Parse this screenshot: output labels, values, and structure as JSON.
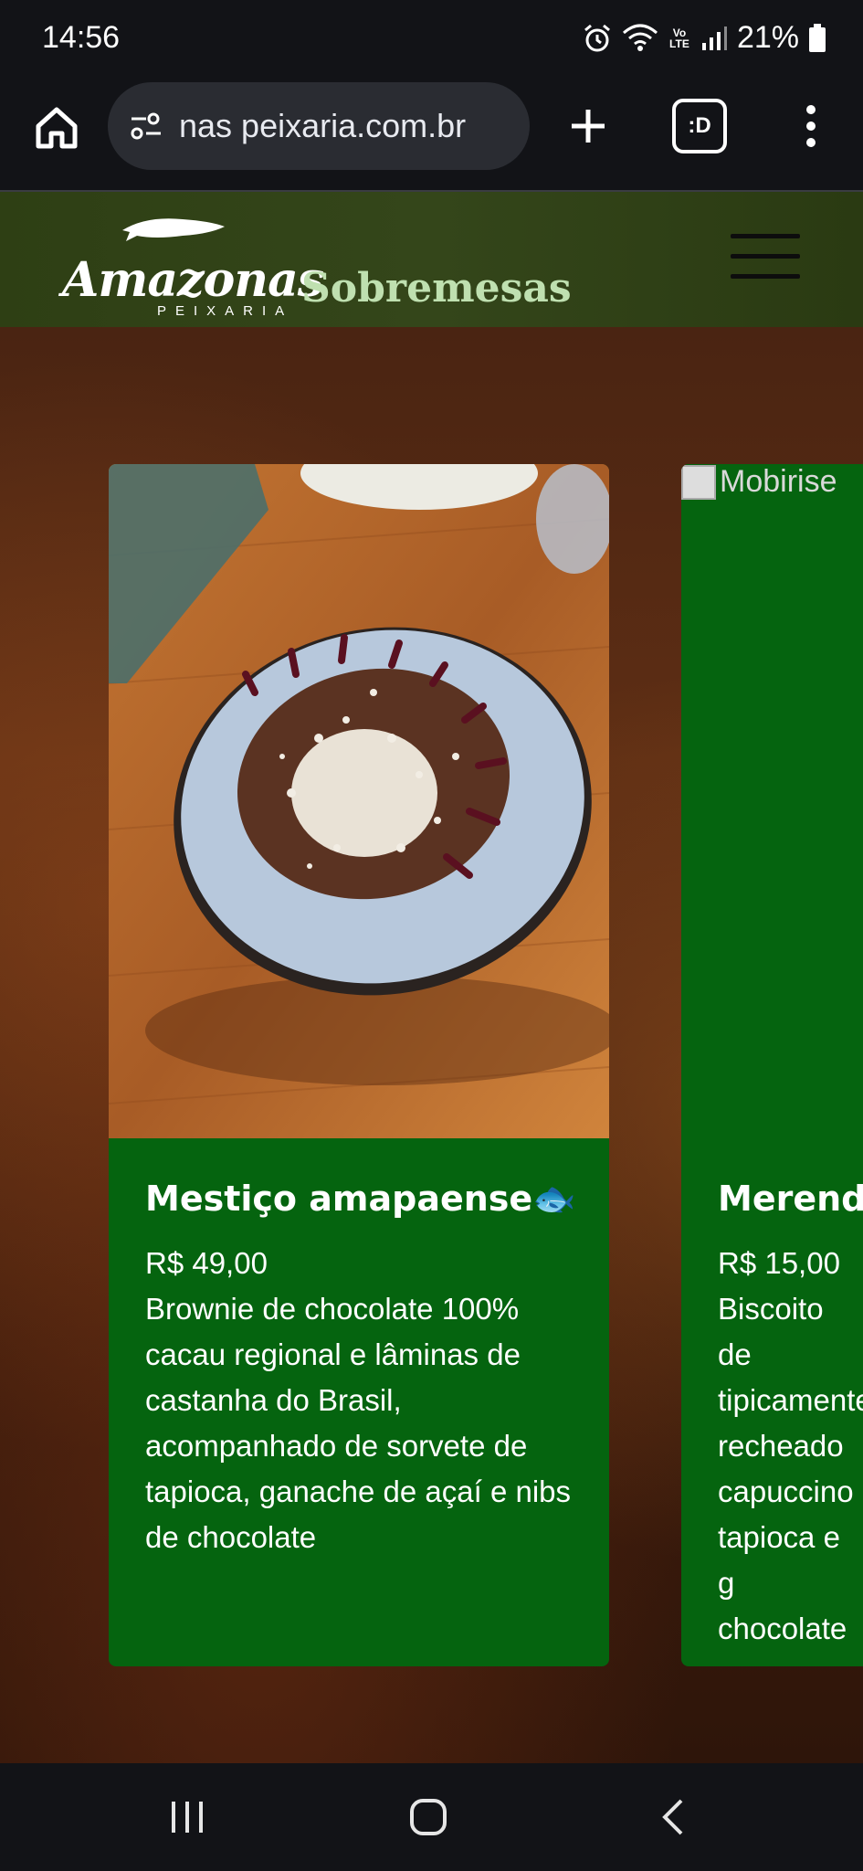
{
  "status_bar": {
    "time": "14:56",
    "network_label": "Vo LTE",
    "battery": "21%"
  },
  "browser": {
    "url": "nas peixaria.com.br",
    "tabs_label": ":D"
  },
  "header": {
    "logo_text": "Amazonas",
    "logo_subtext": "PEIXARIA",
    "page_title": "Sobremesas"
  },
  "cards": [
    {
      "title": "Mestiço amapaense🐟",
      "price": "R$ 49,00",
      "description": "Brownie de chocolate 100% cacau regional e lâminas de castanha do Brasil, acompanhado de sorvete de tapioca, ganache de açaí e nibs de chocolate"
    },
    {
      "image_alt": "Mobirise",
      "title": "Merenda",
      "price": "R$ 15,00",
      "description": "Biscoito de tipicamente recheado capuccino tapioca e g chocolate cumaru"
    }
  ]
}
